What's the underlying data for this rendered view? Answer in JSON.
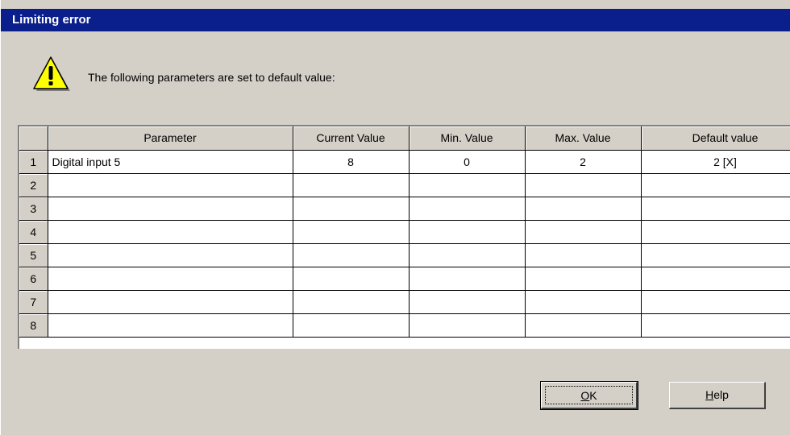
{
  "window": {
    "title": "Limiting error"
  },
  "message": "The following parameters are set to default value:",
  "icons": {
    "warning": "warning-icon"
  },
  "table": {
    "columns": [
      "Parameter",
      "Current Value",
      "Min. Value",
      "Max. Value",
      "Default value"
    ],
    "rows": [
      {
        "num": "1",
        "parameter": "Digital input 5",
        "current": "8",
        "min": "0",
        "max": "2",
        "default": "2 [X]"
      },
      {
        "num": "2",
        "parameter": "",
        "current": "",
        "min": "",
        "max": "",
        "default": ""
      },
      {
        "num": "3",
        "parameter": "",
        "current": "",
        "min": "",
        "max": "",
        "default": ""
      },
      {
        "num": "4",
        "parameter": "",
        "current": "",
        "min": "",
        "max": "",
        "default": ""
      },
      {
        "num": "5",
        "parameter": "",
        "current": "",
        "min": "",
        "max": "",
        "default": ""
      },
      {
        "num": "6",
        "parameter": "",
        "current": "",
        "min": "",
        "max": "",
        "default": ""
      },
      {
        "num": "7",
        "parameter": "",
        "current": "",
        "min": "",
        "max": "",
        "default": ""
      },
      {
        "num": "8",
        "parameter": "",
        "current": "",
        "min": "",
        "max": "",
        "default": ""
      }
    ]
  },
  "buttons": {
    "ok_mnemonic": "O",
    "ok_rest": "K",
    "help_mnemonic": "H",
    "help_rest": "elp"
  },
  "colors": {
    "titlebar": "#0a1e8c",
    "dialog_bg": "#d4d0c8",
    "warning_fill": "#ffff00"
  }
}
